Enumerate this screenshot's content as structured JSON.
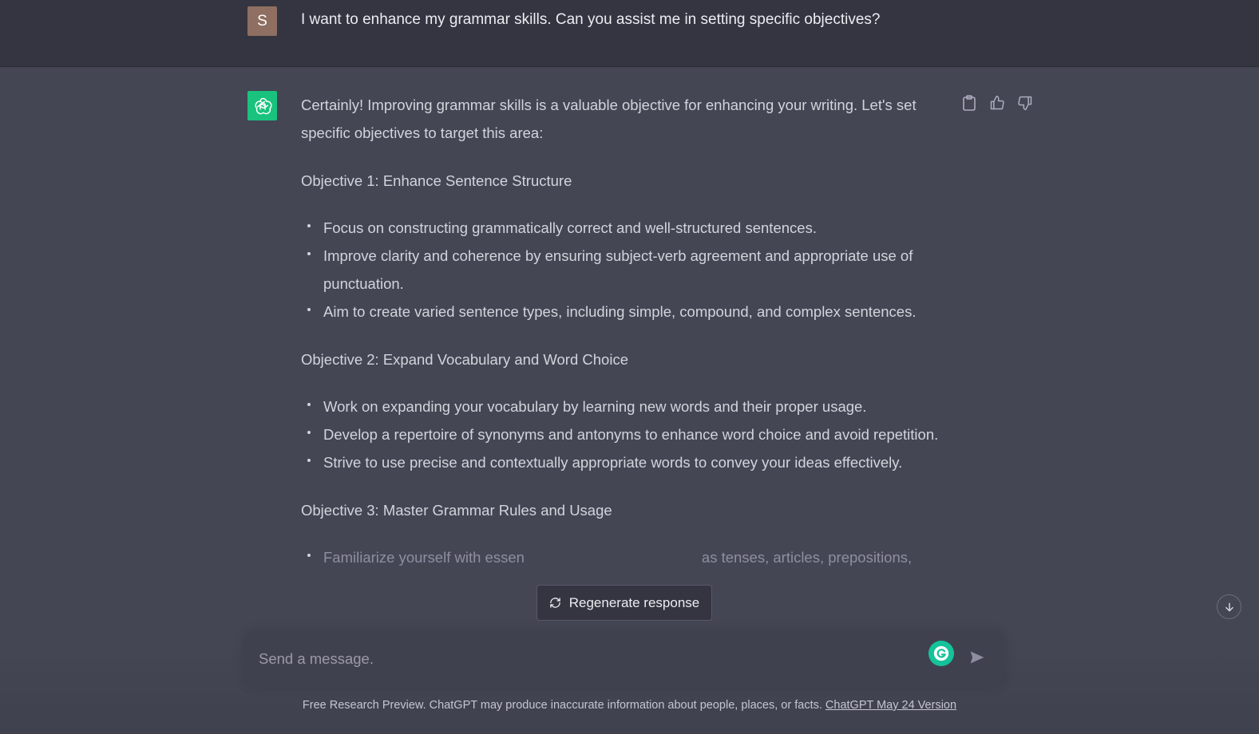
{
  "user_message": {
    "avatar_letter": "S",
    "text": "I want to enhance my grammar skills. Can you assist me in setting specific objectives?"
  },
  "assistant_message": {
    "intro": "Certainly! Improving grammar skills is a valuable objective for enhancing your writing. Let's set specific objectives to target this area:",
    "objectives": [
      {
        "title": "Objective 1: Enhance Sentence Structure",
        "bullets": [
          "Focus on constructing grammatically correct and well-structured sentences.",
          "Improve clarity and coherence by ensuring subject-verb agreement and appropriate use of punctuation.",
          "Aim to create varied sentence types, including simple, compound, and complex sentences."
        ]
      },
      {
        "title": "Objective 2: Expand Vocabulary and Word Choice",
        "bullets": [
          "Work on expanding your vocabulary by learning new words and their proper usage.",
          "Develop a repertoire of synonyms and antonyms to enhance word choice and avoid repetition.",
          "Strive to use precise and contextually appropriate words to convey your ideas effectively."
        ]
      },
      {
        "title": "Objective 3: Master Grammar Rules and Usage",
        "bullets_visible_fragment": {
          "left": "Familiarize yourself with essen",
          "right": "as tenses, articles, prepositions,"
        }
      }
    ],
    "actions": [
      "copy-icon",
      "thumbs-up-icon",
      "thumbs-down-icon"
    ]
  },
  "regenerate_label": "Regenerate response",
  "composer": {
    "placeholder": "Send a message."
  },
  "footer": {
    "text": "Free Research Preview. ChatGPT may produce inaccurate information about people, places, or facts.",
    "link": "ChatGPT May 24 Version"
  },
  "colors": {
    "user_bg": "#343541",
    "assistant_bg": "#444654",
    "gpt_avatar": "#19c37d",
    "user_avatar": "#8f6f61",
    "grammarly": "#15c39a"
  }
}
